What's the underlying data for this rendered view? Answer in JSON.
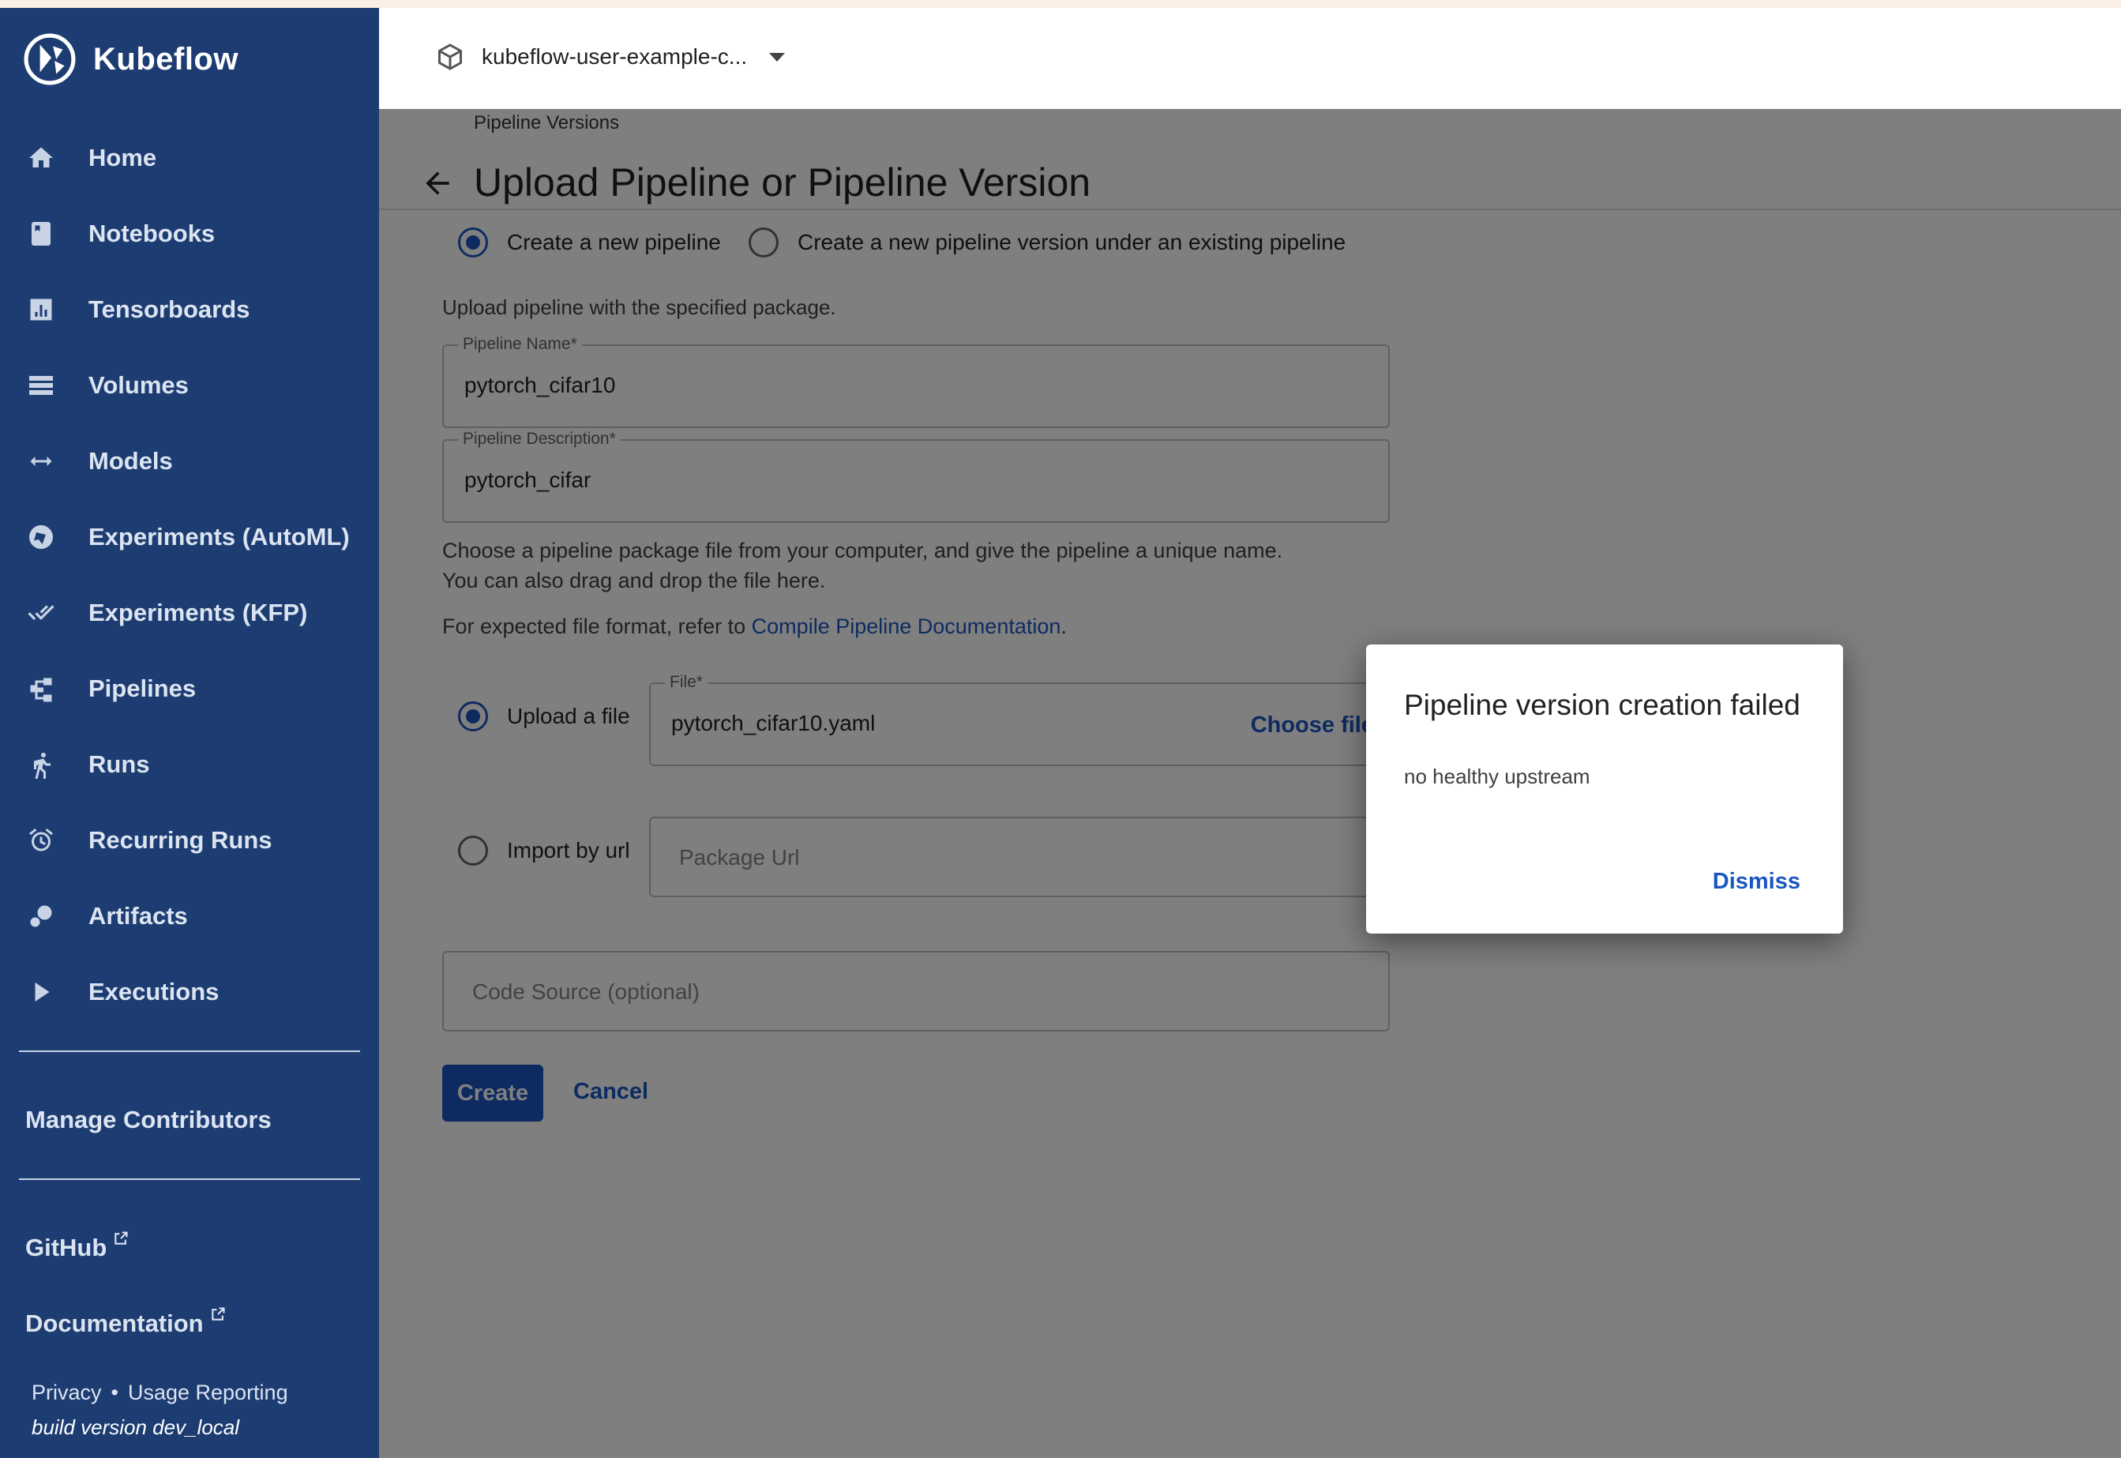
{
  "app": {
    "name": "Kubeflow"
  },
  "namespace": {
    "label": "kubeflow-user-example-c..."
  },
  "sidebar": {
    "items": [
      {
        "label": "Home",
        "icon": "home-icon"
      },
      {
        "label": "Notebooks",
        "icon": "notebook-icon"
      },
      {
        "label": "Tensorboards",
        "icon": "tensorboard-icon"
      },
      {
        "label": "Volumes",
        "icon": "volumes-icon"
      },
      {
        "label": "Models",
        "icon": "models-icon"
      },
      {
        "label": "Experiments (AutoML)",
        "icon": "automl-icon"
      },
      {
        "label": "Experiments (KFP)",
        "icon": "kfp-icon"
      },
      {
        "label": "Pipelines",
        "icon": "pipelines-icon"
      },
      {
        "label": "Runs",
        "icon": "runs-icon"
      },
      {
        "label": "Recurring Runs",
        "icon": "alarm-icon"
      },
      {
        "label": "Artifacts",
        "icon": "artifacts-icon"
      },
      {
        "label": "Executions",
        "icon": "play-icon"
      }
    ],
    "manage_contributors": "Manage Contributors",
    "github": "GitHub",
    "documentation": "Documentation",
    "privacy": "Privacy",
    "separator": "•",
    "usage_reporting": "Usage Reporting",
    "build_version": "build version dev_local"
  },
  "page": {
    "breadcrumb": "Pipeline Versions",
    "title": "Upload Pipeline or Pipeline Version",
    "option_new_pipeline": "Create a new pipeline",
    "option_new_version": "Create a new pipeline version under an existing pipeline",
    "upload_note": "Upload pipeline with the specified package.",
    "pipeline_name_label": "Pipeline Name*",
    "pipeline_name_value": "pytorch_cifar10",
    "pipeline_desc_label": "Pipeline Description*",
    "pipeline_desc_value": "pytorch_cifar",
    "help_line1": "Choose a pipeline package file from your computer, and give the pipeline a unique name.",
    "help_line2": "You can also drag and drop the file here.",
    "format_prefix": "For expected file format, refer to ",
    "format_link": "Compile Pipeline Documentation",
    "format_suffix": ".",
    "upload_file_label": "Upload a file",
    "file_label": "File*",
    "file_value": "pytorch_cifar10.yaml",
    "choose_file": "Choose file",
    "import_url_label": "Import by url",
    "package_url_placeholder": "Package Url",
    "code_source_placeholder": "Code Source (optional)",
    "create": "Create",
    "cancel": "Cancel"
  },
  "dialog": {
    "title": "Pipeline version creation failed",
    "message": "no healthy upstream",
    "dismiss": "Dismiss"
  },
  "colors": {
    "sidebar": "#1d3d72",
    "accent": "#1a56c2",
    "overlay": "rgba(0,0,0,0.5)"
  }
}
